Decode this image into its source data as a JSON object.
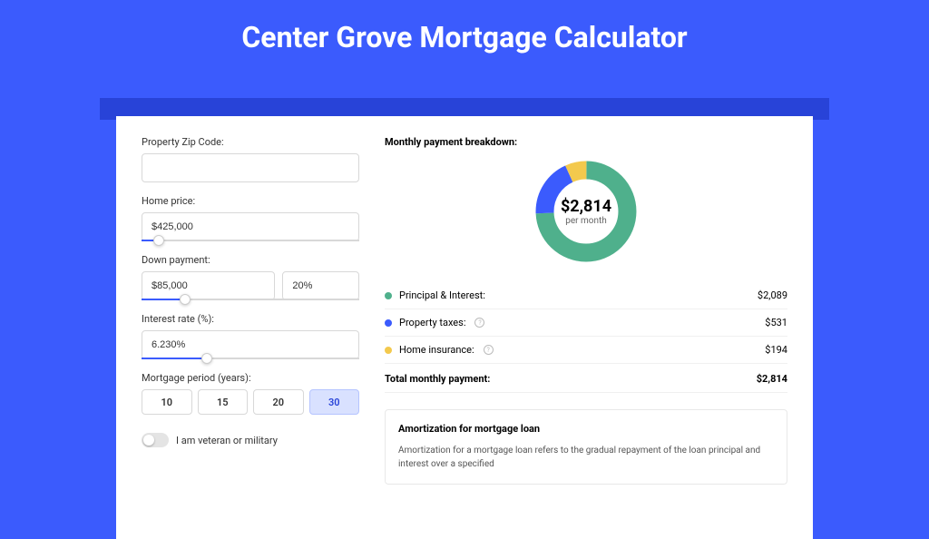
{
  "title": "Center Grove Mortgage Calculator",
  "form": {
    "zip_label": "Property Zip Code:",
    "zip_value": "",
    "home_price_label": "Home price:",
    "home_price_value": "$425,000",
    "home_price_slider_pct": 8,
    "down_label": "Down payment:",
    "down_value": "$85,000",
    "down_pct": "20%",
    "down_slider_pct": 20,
    "rate_label": "Interest rate (%):",
    "rate_value": "6.230%",
    "rate_slider_pct": 30,
    "period_label": "Mortgage period (years):",
    "periods": [
      "10",
      "15",
      "20",
      "30"
    ],
    "period_selected": "30",
    "veteran_label": "I am veteran or military"
  },
  "breakdown": {
    "title": "Monthly payment breakdown:",
    "amount": "$2,814",
    "per": "per month",
    "items": [
      {
        "label": "Principal & Interest:",
        "value": "$2,089",
        "color": "#4fb08c",
        "info": false
      },
      {
        "label": "Property taxes:",
        "value": "$531",
        "color": "#3b5bfd",
        "info": true
      },
      {
        "label": "Home insurance:",
        "value": "$194",
        "color": "#f3c94d",
        "info": true
      }
    ],
    "total_label": "Total monthly payment:",
    "total_value": "$2,814"
  },
  "amort": {
    "title": "Amortization for mortgage loan",
    "text": "Amortization for a mortgage loan refers to the gradual repayment of the loan principal and interest over a specified"
  },
  "chart_data": {
    "type": "pie",
    "title": "Monthly payment breakdown",
    "series": [
      {
        "name": "Principal & Interest",
        "value": 2089,
        "color": "#4fb08c"
      },
      {
        "name": "Property taxes",
        "value": 531,
        "color": "#3b5bfd"
      },
      {
        "name": "Home insurance",
        "value": 194,
        "color": "#f3c94d"
      }
    ],
    "total": 2814,
    "center_label": "$2,814 per month"
  }
}
